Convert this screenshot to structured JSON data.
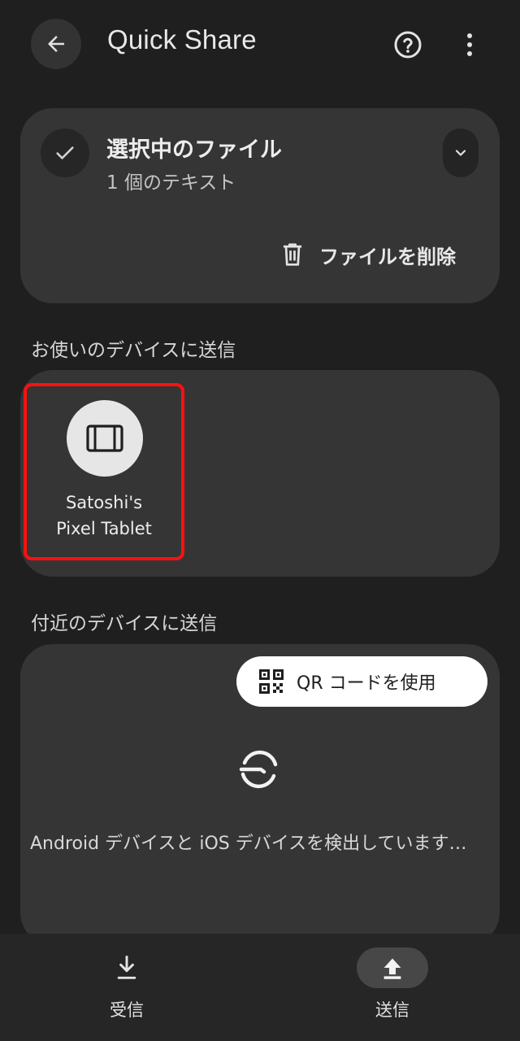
{
  "header": {
    "title": "Quick Share",
    "back_icon": "arrow-back-icon",
    "help_icon": "help-icon",
    "more_icon": "more-vert-icon"
  },
  "file_card": {
    "title": "選択中のファイル",
    "subtitle": "1 個のテキスト",
    "delete_label": "ファイルを削除"
  },
  "my_devices": {
    "section_label": "お使いのデバイスに送信",
    "devices": [
      {
        "name_line1": "Satoshi's",
        "name_line2": "Pixel Tablet",
        "icon": "tablet-icon"
      }
    ]
  },
  "nearby": {
    "section_label": "付近のデバイスに送信",
    "qr_label": "QR コードを使用",
    "status_text": "Android デバイスと iOS デバイスを検出しています…"
  },
  "bottom_nav": {
    "receive_label": "受信",
    "send_label": "送信",
    "active": "send"
  },
  "colors": {
    "background": "#1f1f1f",
    "card": "#353535",
    "highlight": "#ff1010"
  }
}
